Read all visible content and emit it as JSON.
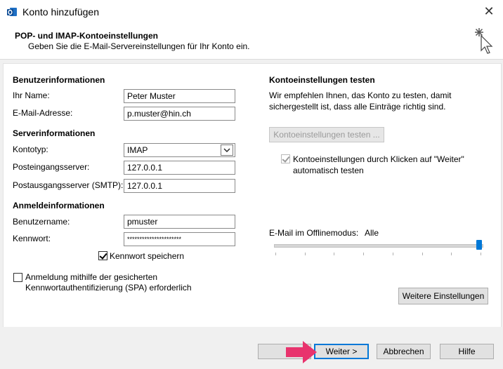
{
  "window": {
    "title": "Konto hinzufügen",
    "close_glyph": "✕"
  },
  "header": {
    "title": "POP- und IMAP-Kontoeinstellungen",
    "subtitle": "Geben Sie die E-Mail-Servereinstellungen für Ihr Konto ein."
  },
  "user_info": {
    "section": "Benutzerinformationen",
    "name_label": "Ihr Name:",
    "name_value": "Peter Muster",
    "email_label": "E-Mail-Adresse:",
    "email_value": "p.muster@hin.ch"
  },
  "server_info": {
    "section": "Serverinformationen",
    "type_label": "Kontotyp:",
    "type_value": "IMAP",
    "incoming_label": "Posteingangsserver:",
    "incoming_value": "127.0.0.1",
    "outgoing_label": "Postausgangsserver (SMTP):",
    "outgoing_value": "127.0.0.1"
  },
  "login_info": {
    "section": "Anmeldeinformationen",
    "user_label": "Benutzername:",
    "user_value": "pmuster",
    "password_label": "Kennwort:",
    "password_value": "**********************",
    "remember_label": "Kennwort speichern",
    "remember_checked": true
  },
  "spa": {
    "label_line1": "Anmeldung mithilfe der gesicherten",
    "label_line2": "Kennwortauthentifizierung (SPA) erforderlich",
    "checked": false
  },
  "test": {
    "section": "Kontoeinstellungen testen",
    "desc_line1": "Wir empfehlen Ihnen, das Konto zu testen, damit",
    "desc_line2": "sichergestellt ist, dass alle Einträge richtig sind.",
    "button": "Kontoeinstellungen testen ...",
    "auto_line1": "Kontoeinstellungen durch Klicken auf \"Weiter\"",
    "auto_line2": "automatisch testen",
    "auto_checked": true
  },
  "offline": {
    "label": "E-Mail im Offlinemodus:",
    "value": "Alle",
    "slider_fraction": 1.0
  },
  "more_settings_button": "Weitere Einstellungen",
  "footer": {
    "back": "",
    "next": "Weiter >",
    "cancel": "Abbrechen",
    "help": "Hilfe"
  },
  "colors": {
    "accent": "#0078d7",
    "annotation_arrow": "#e8336d"
  },
  "icons": {
    "app": "outlook-icon",
    "wizard": "cursor-sparkle-icon",
    "dropdown": "chevron-down-icon"
  }
}
